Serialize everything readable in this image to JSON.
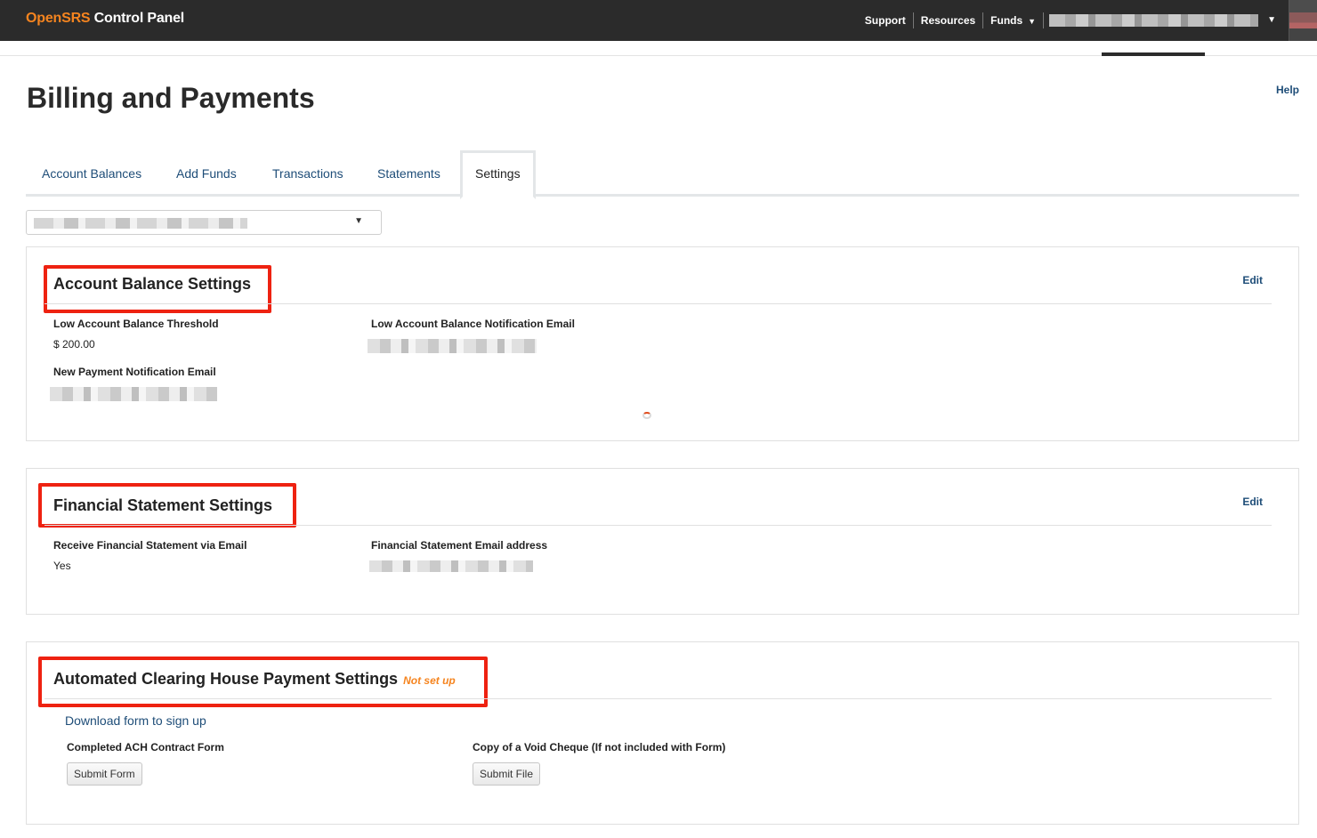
{
  "app": {
    "brand_prefix": "OpenSRS",
    "brand_suffix": " Control Panel"
  },
  "topnav": {
    "items": [
      {
        "label": "Support"
      },
      {
        "label": "Resources"
      },
      {
        "label": "Funds"
      }
    ],
    "account_name_redacted": true
  },
  "page": {
    "title": "Billing and Payments",
    "help_label": "Help"
  },
  "tabs": [
    {
      "label": "Account Balances",
      "active": false
    },
    {
      "label": "Add Funds",
      "active": false
    },
    {
      "label": "Transactions",
      "active": false
    },
    {
      "label": "Statements",
      "active": false
    },
    {
      "label": "Settings",
      "active": true
    }
  ],
  "account_selector": {
    "value_redacted": true
  },
  "account_balance_settings": {
    "title": "Account Balance Settings",
    "edit_label": "Edit",
    "low_threshold_label": "Low Account Balance Threshold",
    "low_threshold_value": "$ 200.00",
    "low_email_label": "Low Account Balance Notification Email",
    "new_payment_email_label": "New Payment Notification Email"
  },
  "financial_statement_settings": {
    "title": "Financial Statement Settings",
    "edit_label": "Edit",
    "receive_label": "Receive Financial Statement via Email",
    "receive_value": "Yes",
    "email_label": "Financial Statement Email address"
  },
  "ach_settings": {
    "title": "Automated Clearing House Payment Settings",
    "status": "Not set up",
    "download_link": "Download form to sign up",
    "contract_label": "Completed ACH Contract Form",
    "contract_button": "Submit Form",
    "cheque_label": "Copy of a Void Cheque (If not included with Form)",
    "cheque_button": "Submit File"
  },
  "colors": {
    "brand_orange": "#f5841f",
    "link_blue": "#1e4d78",
    "topbar_bg": "#2b2b2b",
    "highlight_red": "#ee2211"
  }
}
